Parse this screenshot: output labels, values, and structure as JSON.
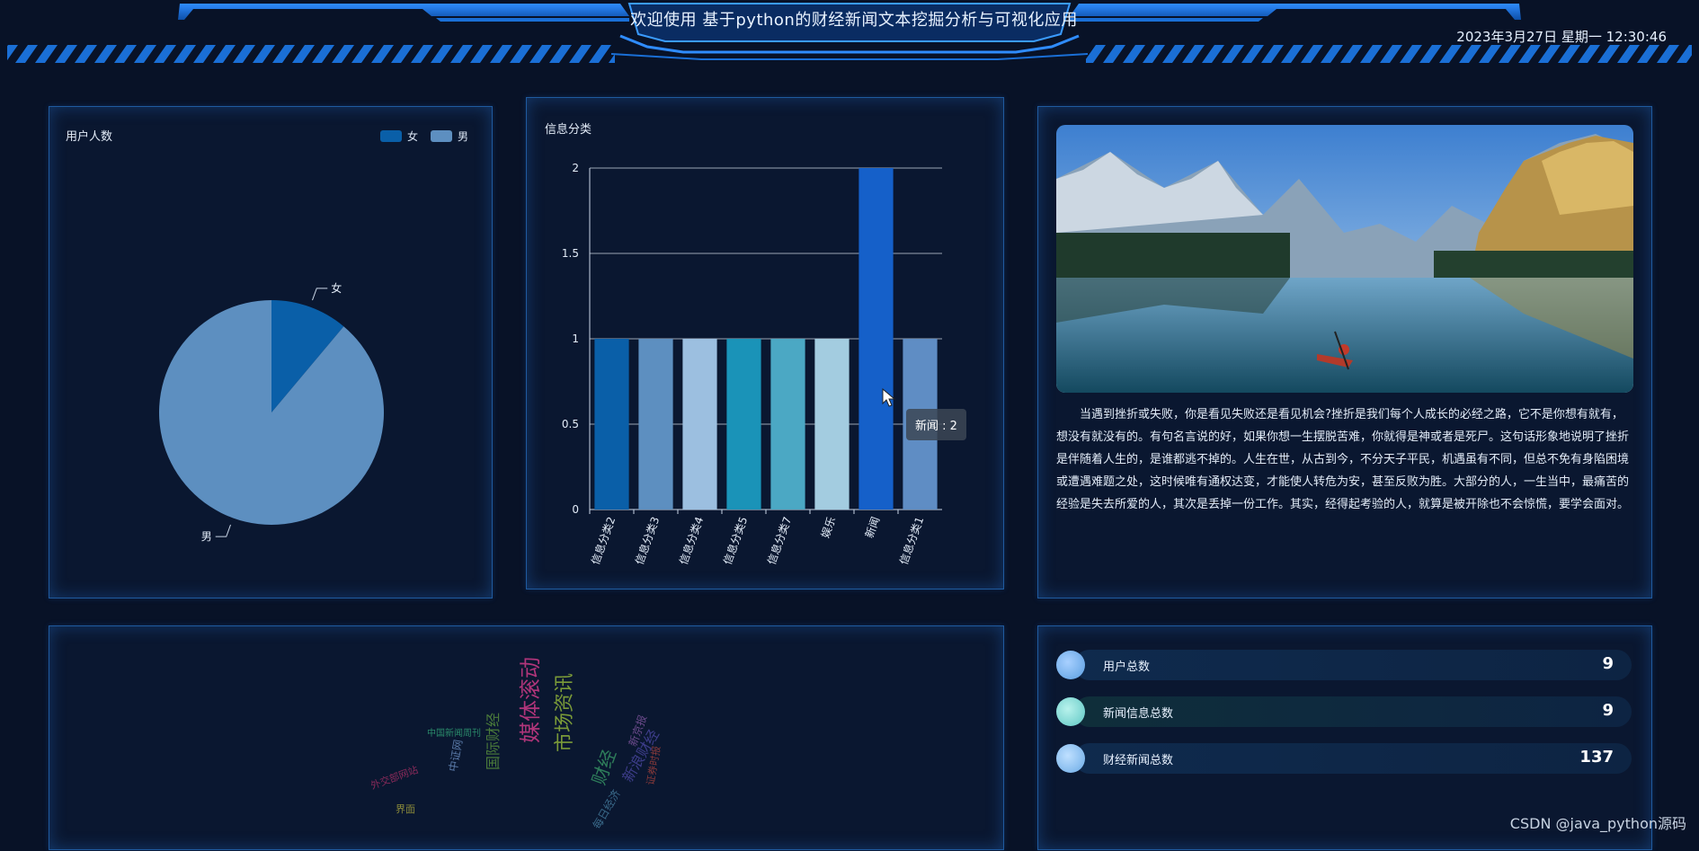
{
  "header": {
    "title": "欢迎使用 基于python的财经新闻文本挖掘分析与可视化应用",
    "datetime": "2023年3月27日 星期一 12:30:46"
  },
  "user_panel": {
    "title": "用户人数",
    "legend": [
      {
        "label": "女",
        "color": "#0a5fa8"
      },
      {
        "label": "男",
        "color": "#5d8fc0"
      }
    ]
  },
  "info_panel": {
    "title": "信息分类",
    "tooltip": "新闻 : 2"
  },
  "chart_data": [
    {
      "type": "pie",
      "title": "用户人数",
      "labels": [
        "女",
        "男"
      ],
      "values": [
        1,
        8
      ],
      "colors": [
        "#0a5fa8",
        "#5d8fc0"
      ],
      "legend": "top-right"
    },
    {
      "type": "bar",
      "title": "信息分类",
      "categories": [
        "信息分类2",
        "信息分类3",
        "信息分类4",
        "信息分类5",
        "信息分类7",
        "娱乐",
        "新闻",
        "信息分类1"
      ],
      "values": [
        1,
        1,
        1,
        1,
        1,
        1,
        2,
        1
      ],
      "colors": [
        "#0a5fa8",
        "#5d8fc0",
        "#9cbfe0",
        "#1a93b8",
        "#4ba8c4",
        "#a3cce0",
        "#1560c9",
        "#5f8dc4"
      ],
      "ylim": [
        0,
        2
      ],
      "yticks": [
        "0",
        "0.5",
        "1",
        "1.5",
        "2"
      ],
      "grid": true
    }
  ],
  "article": {
    "text": "当遇到挫折或失败，你是看见失败还是看见机会?挫折是我们每个人成长的必经之路，它不是你想有就有，想没有就没有的。有句名言说的好，如果你想一生摆脱苦难，你就得是神或者是死尸。这句话形象地说明了挫折是伴随着人生的，是谁都逃不掉的。人生在世，从古到今，不分天子平民，机遇虽有不同，但总不免有身陷困境或遭遇难题之处，这时候唯有通权达变，才能使人转危为安，甚至反败为胜。大部分的人，一生当中，最痛苦的经验是失去所爱的人，其次是丢掉一份工作。其实，经得起考验的人，就算是被开除也不会惊慌，要学会面对。"
  },
  "wordcloud": {
    "words": [
      {
        "text": "媒体滚动",
        "color": "#b0357a"
      },
      {
        "text": "市场资讯",
        "color": "#7a9a38"
      },
      {
        "text": "财经",
        "color": "#2e7d5a"
      },
      {
        "text": "新浪财经",
        "color": "#3d3d8a"
      },
      {
        "text": "国际财经",
        "color": "#4a7a3a"
      },
      {
        "text": "中国新闻周刊",
        "color": "#2a8a6a"
      },
      {
        "text": "外交部网站",
        "color": "#8a2a5a"
      },
      {
        "text": "界面",
        "color": "#8a8a3a"
      },
      {
        "text": "中证网",
        "color": "#5a7aa8"
      },
      {
        "text": "新京报",
        "color": "#6a4a8a"
      },
      {
        "text": "证券时报",
        "color": "#8a3a3a"
      },
      {
        "text": "每日经济",
        "color": "#3a6a8a"
      }
    ]
  },
  "stats": [
    {
      "label": "用户总数",
      "value": "9",
      "color": "#5a9ee0"
    },
    {
      "label": "新闻信息总数",
      "value": "9",
      "color": "#5ec7c4"
    },
    {
      "label": "财经新闻总数",
      "value": "137",
      "color": "#6aaae6"
    }
  ],
  "watermark": "CSDN @java_python源码"
}
